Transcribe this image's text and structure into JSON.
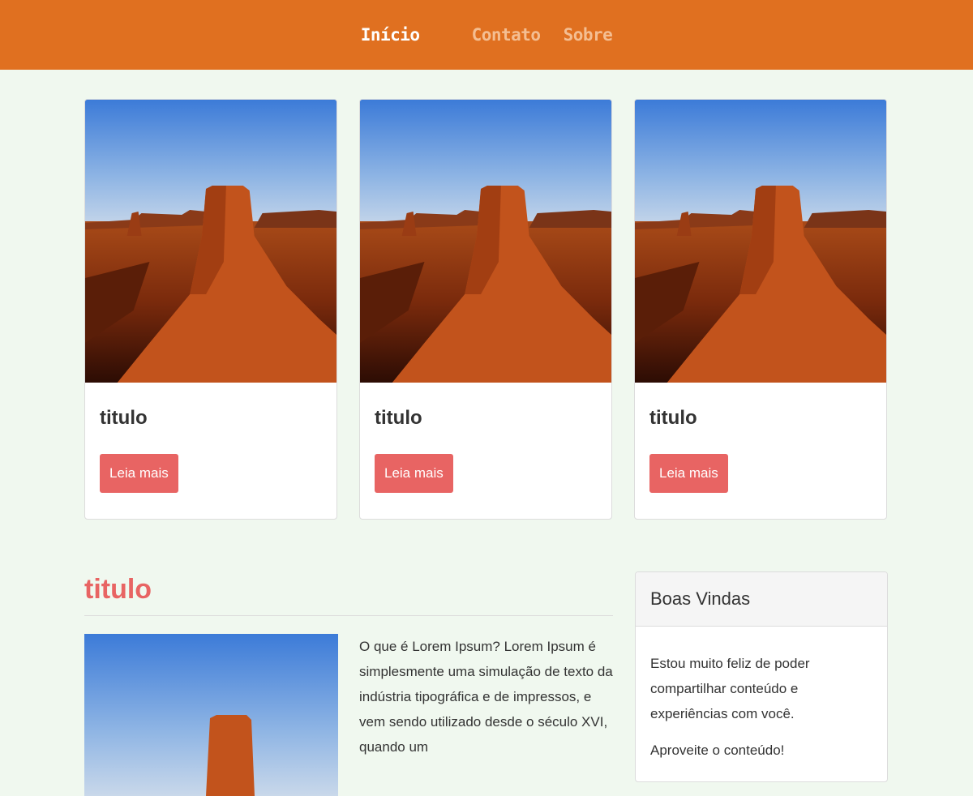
{
  "nav": {
    "items": [
      {
        "label": "Início",
        "active": true
      },
      {
        "label": "Contato",
        "active": false
      },
      {
        "label": "Sobre",
        "active": false
      }
    ]
  },
  "cards": [
    {
      "title": "titulo",
      "button": "Leia mais"
    },
    {
      "title": "titulo",
      "button": "Leia mais"
    },
    {
      "title": "titulo",
      "button": "Leia mais"
    }
  ],
  "main": {
    "title": "titulo",
    "article_text": "O que é Lorem Ipsum? Lorem Ipsum é simplesmente uma simulação de texto da indústria tipográfica e de impressos, e vem sendo utilizado desde o século XVI, quando um"
  },
  "sidebar": {
    "title": "Boas Vindas",
    "paragraph1": "Estou muito feliz de poder compartilhar conteúdo e experiências com você.",
    "paragraph2": "Aproveite o conteúdo!"
  },
  "colors": {
    "nav_bg": "#e07020",
    "page_bg": "#f0f8ef",
    "accent_red": "#e86463"
  }
}
